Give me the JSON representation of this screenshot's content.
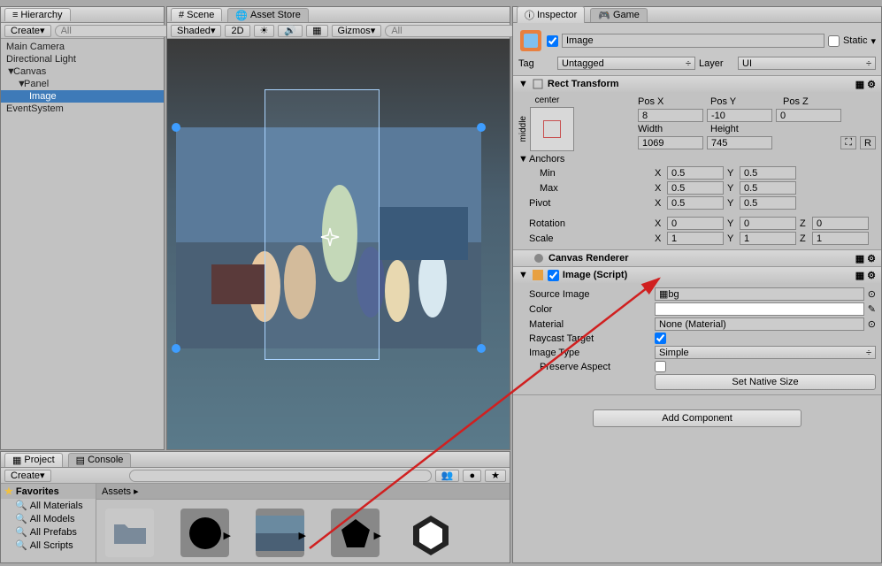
{
  "hierarchy": {
    "tab": "Hierarchy",
    "create": "Create",
    "search_placeholder": "All",
    "items": [
      "Main Camera",
      "Directional Light",
      "Canvas",
      "Panel",
      "Image",
      "EventSystem"
    ]
  },
  "scene": {
    "tab_scene": "Scene",
    "tab_assetstore": "Asset Store",
    "shading": "Shaded",
    "mode2d": "2D",
    "gizmos": "Gizmos",
    "search_placeholder": "All"
  },
  "inspector": {
    "tab_inspector": "Inspector",
    "tab_game": "Game",
    "name": "Image",
    "static": "Static",
    "tag_label": "Tag",
    "tag_value": "Untagged",
    "layer_label": "Layer",
    "layer_value": "UI",
    "rect_transform": {
      "title": "Rect Transform",
      "center": "center",
      "middle": "middle",
      "posx_label": "Pos X",
      "posx": "8",
      "posy_label": "Pos Y",
      "posy": "-10",
      "posz_label": "Pos Z",
      "posz": "0",
      "width_label": "Width",
      "width": "1069",
      "height_label": "Height",
      "height": "745",
      "anchors": "Anchors",
      "min": "Min",
      "min_x": "0.5",
      "min_y": "0.5",
      "max": "Max",
      "max_x": "0.5",
      "max_y": "0.5",
      "pivot": "Pivot",
      "pivot_x": "0.5",
      "pivot_y": "0.5",
      "rotation": "Rotation",
      "rot_x": "0",
      "rot_y": "0",
      "rot_z": "0",
      "scale": "Scale",
      "scale_x": "1",
      "scale_y": "1",
      "scale_z": "1"
    },
    "canvas_renderer": "Canvas Renderer",
    "image": {
      "title": "Image (Script)",
      "source_image": "Source Image",
      "source_image_val": "bg",
      "color": "Color",
      "material": "Material",
      "material_val": "None (Material)",
      "raycast_target": "Raycast Target",
      "image_type": "Image Type",
      "image_type_val": "Simple",
      "preserve_aspect": "Preserve Aspect",
      "set_native": "Set Native Size"
    },
    "add_component": "Add Component"
  },
  "project": {
    "tab_project": "Project",
    "tab_console": "Console",
    "create": "Create",
    "favorites": "Favorites",
    "fav_items": [
      "All Materials",
      "All Models",
      "All Prefabs",
      "All Scripts"
    ],
    "assets": "Assets"
  },
  "labels": {
    "x": "X",
    "y": "Y",
    "z": "Z",
    "r": "R"
  }
}
